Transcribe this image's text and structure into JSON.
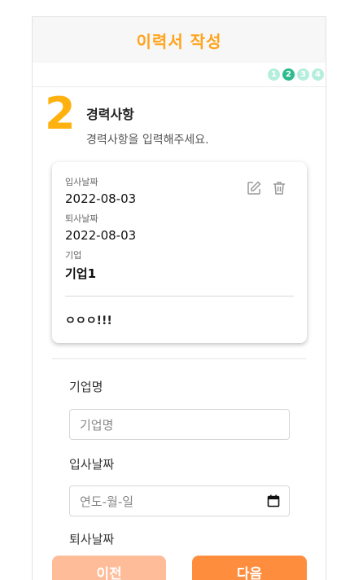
{
  "header": {
    "title": "이력서 작성"
  },
  "steps": [
    {
      "label": "1",
      "active": false
    },
    {
      "label": "2",
      "active": true
    },
    {
      "label": "3",
      "active": false
    },
    {
      "label": "4",
      "active": false
    }
  ],
  "section": {
    "number": "2",
    "title": "경력사항",
    "subtitle": "경력사항을 입력해주세요."
  },
  "career_card": {
    "start_label": "입사날짜",
    "start_value": "2022-08-03",
    "end_label": "퇴사날짜",
    "end_value": "2022-08-03",
    "company_label": "기업",
    "company_value": "기업1",
    "memo": "ㅇㅇㅇ!!!",
    "edit_icon": "edit-icon",
    "delete_icon": "trash-icon"
  },
  "form": {
    "company_label": "기업명",
    "company_placeholder": "기업명",
    "start_label": "입사날짜",
    "start_placeholder": "연도-월-일",
    "end_label": "퇴사날짜"
  },
  "nav": {
    "prev_label": "이전",
    "next_label": "다음"
  },
  "colors": {
    "accent": "#ffa41c",
    "step_active": "#2ebb8e",
    "step_inactive": "#b6eedd",
    "prev_button": "#ffbc98",
    "next_button": "#ff8d3e"
  }
}
